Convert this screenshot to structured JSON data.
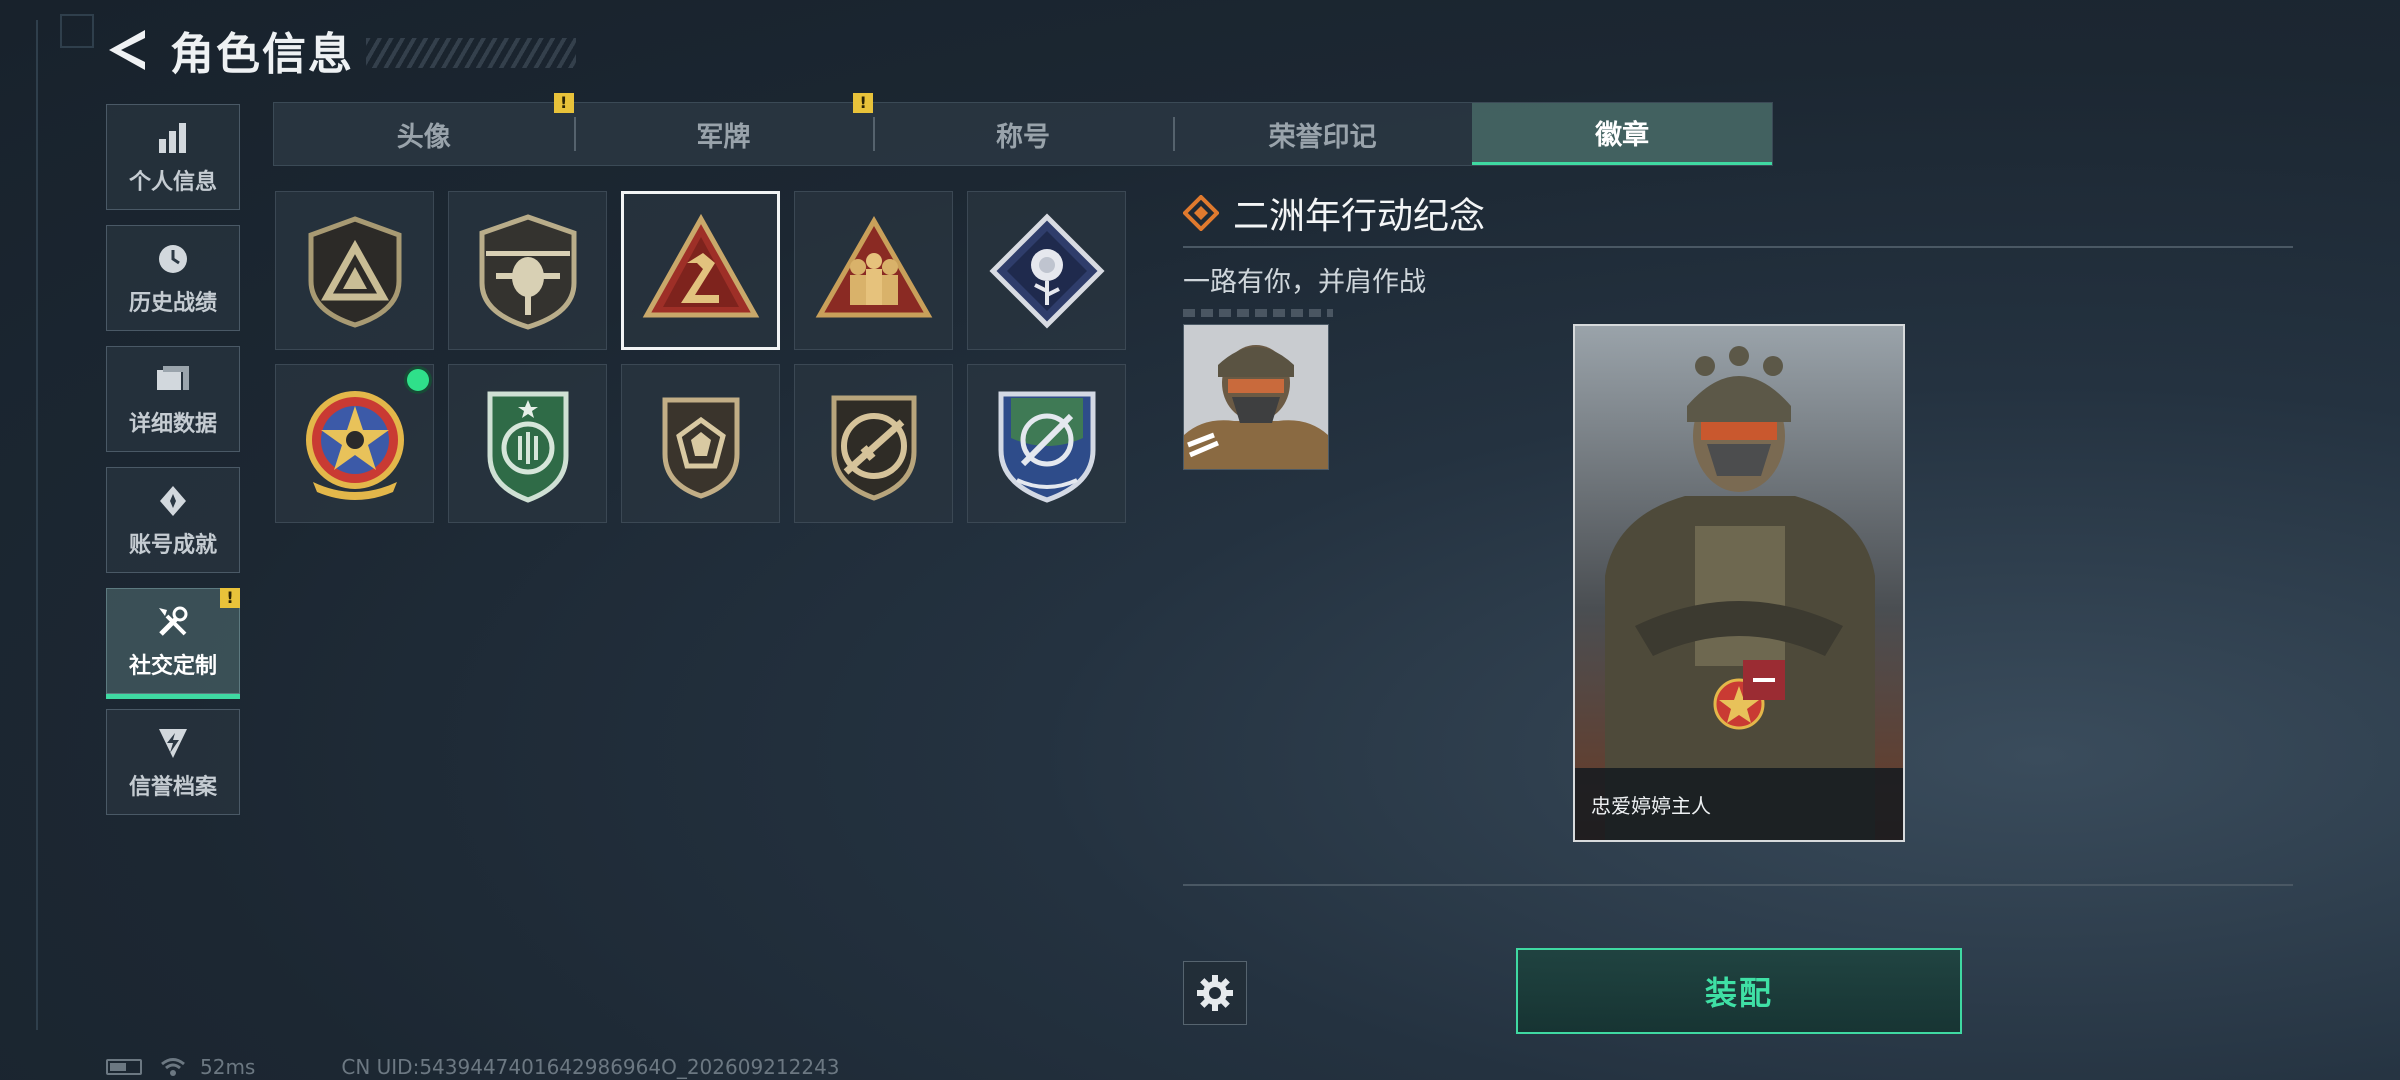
{
  "header": {
    "title": "角色信息"
  },
  "sidebar": {
    "items": [
      {
        "label": "个人信息",
        "icon": "bar-chart-icon",
        "active": false
      },
      {
        "label": "历史战绩",
        "icon": "history-icon",
        "active": false
      },
      {
        "label": "详细数据",
        "icon": "cards-icon",
        "active": false
      },
      {
        "label": "账号成就",
        "icon": "achievement-icon",
        "active": false
      },
      {
        "label": "社交定制",
        "icon": "tools-icon",
        "active": true,
        "alert": "!"
      },
      {
        "label": "信誉档案",
        "icon": "shield-bolt-icon",
        "active": false
      }
    ]
  },
  "tabs": [
    {
      "label": "头像",
      "alert": "!"
    },
    {
      "label": "军牌",
      "alert": "!"
    },
    {
      "label": "称号"
    },
    {
      "label": "荣誉印记"
    },
    {
      "label": "徽章",
      "active": true
    }
  ],
  "badges": [
    {
      "icon": "triangle-emblem-badge-icon"
    },
    {
      "icon": "helicopter-badge-icon"
    },
    {
      "icon": "number-two-badge-icon",
      "selected": true
    },
    {
      "icon": "soldiers-badge-icon"
    },
    {
      "icon": "rose-badge-icon"
    },
    {
      "icon": "star-skull-badge-icon",
      "equipped": true
    },
    {
      "icon": "green-shield-badge-icon"
    },
    {
      "icon": "gem-shield-badge-icon"
    },
    {
      "icon": "rifle-shield-badge-icon"
    },
    {
      "icon": "crosshair-knife-badge-icon"
    }
  ],
  "detail": {
    "title": "二洲年行动纪念",
    "description": "一路有你，并肩作战"
  },
  "preview": {
    "player_name": "忠爱婷婷主人"
  },
  "actions": {
    "equip_label": "装配"
  },
  "status_bar": {
    "ping": "52ms",
    "uid": "CN UID:5439447401642986964O_202609212243"
  },
  "colors": {
    "accent": "#3fd9a2",
    "alert": "#e8c23a",
    "title_icon": "#e07a2e"
  }
}
